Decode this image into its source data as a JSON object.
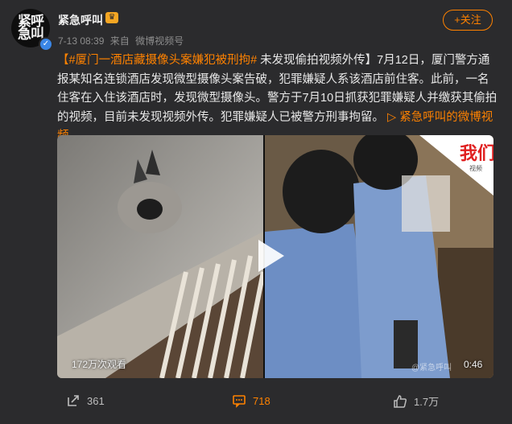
{
  "post": {
    "avatar_text": "紧呼急叫",
    "username": "紧急呼叫",
    "vip_icon": "crown-icon",
    "time": "7-13 08:39",
    "source_prefix": "来自",
    "source": "微博视频号",
    "follow_label": "+关注",
    "body": {
      "open_bracket": "【",
      "hashtag": "#厦门一酒店藏摄像头案嫌犯被刑拘#",
      "text": " 未发现偷拍视频外传】7月12日，厦门警方通报某知名连锁酒店发现微型摄像头案告破，犯罪嫌疑人系该酒店前住客。此前，一名住客在入住该酒店时，发现微型摄像头。警方于7月10日抓获犯罪嫌疑人并缴获其偷拍的视频，目前未发现视频外传。犯罪嫌疑人已被警方刑事拘留。",
      "link_icon": "link-icon",
      "link_text": "紧急呼叫的微博视频"
    }
  },
  "video": {
    "views": "172万次观看",
    "duration": "0:46",
    "watermark": "@紧急呼叫",
    "badge_text": "我们",
    "badge_sub": "视频"
  },
  "actions": {
    "repost_count": "361",
    "comment_count": "718",
    "like_count": "1.7万"
  },
  "colors": {
    "accent": "#ff8200",
    "background": "#2b2b2d"
  }
}
